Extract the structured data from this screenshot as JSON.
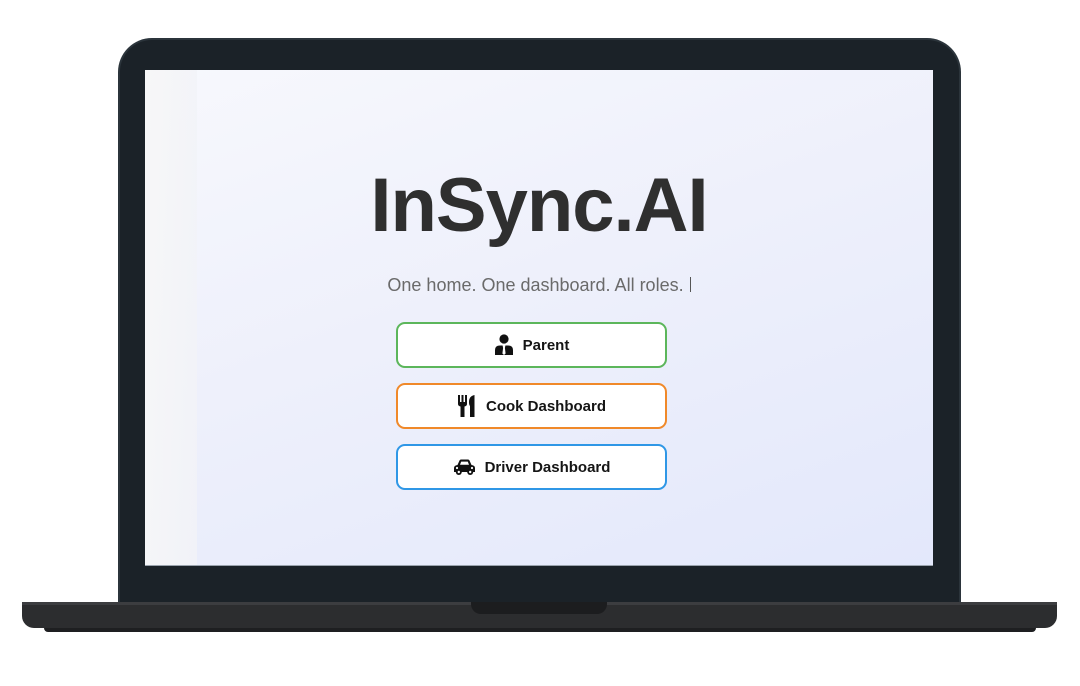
{
  "app": {
    "title": "InSync.AI",
    "tagline": "One home. One dashboard. All roles."
  },
  "roles": [
    {
      "label": "Parent",
      "icon": "parent-icon",
      "border_color": "#5cb65b"
    },
    {
      "label": "Cook Dashboard",
      "icon": "utensils-icon",
      "border_color": "#f0892a"
    },
    {
      "label": "Driver Dashboard",
      "icon": "car-icon",
      "border_color": "#2f97e6"
    }
  ]
}
